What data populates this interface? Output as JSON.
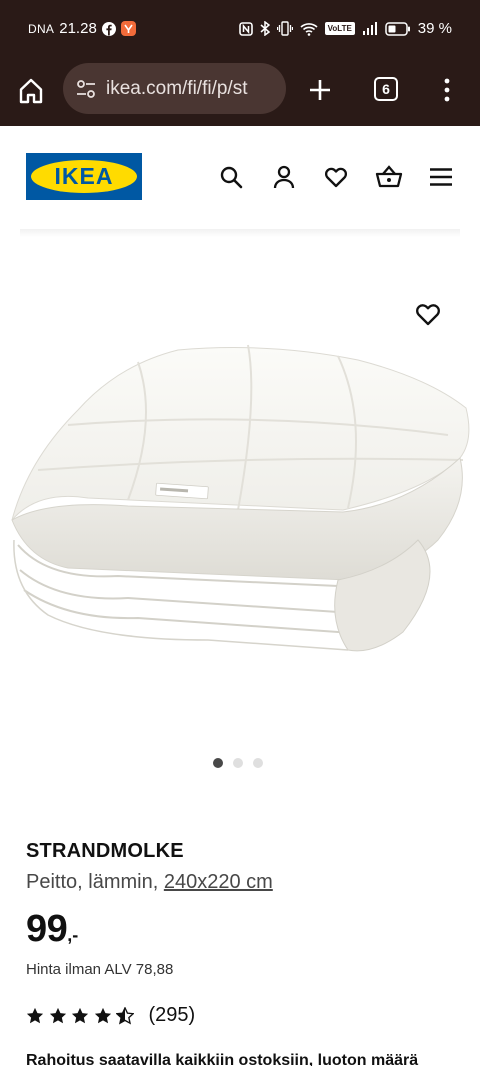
{
  "status_bar": {
    "carrier": "DNA",
    "time": "21.28",
    "battery_percent": "39 %",
    "volte": "VoLTE",
    "icons": [
      "facebook-icon",
      "notification-app-icon",
      "nfc-icon",
      "bluetooth-icon",
      "vibrate-icon",
      "wifi-icon",
      "volte-icon",
      "signal-icon",
      "battery-icon"
    ]
  },
  "browser": {
    "url": "ikea.com/fi/fi/p/st",
    "tab_count": "6"
  },
  "header": {
    "logo_text": "IKEA",
    "icons": [
      "search-icon",
      "account-icon",
      "favourites-icon",
      "cart-icon",
      "hamburger-menu-icon"
    ]
  },
  "gallery": {
    "image_count": 3,
    "active_index": 0
  },
  "product": {
    "name": "STRANDMOLKE",
    "description": "Peitto, lämmin,",
    "size": "240x220 cm",
    "price": "99",
    "price_suffix": ",-",
    "vat_text": "Hinta ilman ALV 78,88",
    "rating": 4.5,
    "rating_max": 5,
    "review_count": "(295)",
    "financing_text": "Rahoitus saatavilla kaikkiin ostoksiin, luoton määrä"
  },
  "colors": {
    "browser_bg": "#2a1a17",
    "url_box_bg": "#4a3632",
    "ikea_blue": "#0058a3",
    "ikea_yellow": "#ffdb00"
  }
}
